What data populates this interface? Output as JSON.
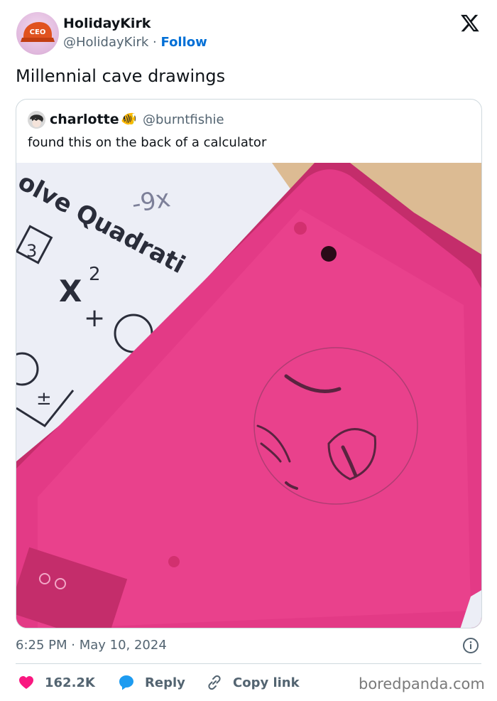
{
  "author": {
    "name": "HolidayKirk",
    "handle": "@HolidayKirk",
    "separator": "·",
    "follow_label": "Follow",
    "avatar_cap_text": "CEO"
  },
  "tweet": {
    "text": "Millennial cave drawings"
  },
  "quoted": {
    "name": "charlotte",
    "emoji": "🐠",
    "handle": "@burntfishie",
    "text": "found this on the back of a calculator",
    "photo": {
      "paper_text": "olve Quadrati",
      "paper_box_number": "3",
      "paper_formula": "X",
      "paper_superscript": "2",
      "paper_plus": "+",
      "paper_plusminus": "±",
      "scribble": "-9x"
    }
  },
  "meta": {
    "timestamp": "6:25 PM · May 10, 2024"
  },
  "actions": {
    "like_count": "162.2K",
    "reply_label": "Reply",
    "copy_label": "Copy link"
  },
  "watermark": "boredpanda.com",
  "icons": {
    "logo": "x-logo-icon",
    "info": "info-icon",
    "like": "heart-icon",
    "reply": "reply-bubble-icon",
    "copy": "link-icon"
  },
  "colors": {
    "follow": "#006fd6",
    "like": "#f91880",
    "reply": "#1d9bf0",
    "muted": "#536471",
    "calculator": "#e33a86"
  }
}
